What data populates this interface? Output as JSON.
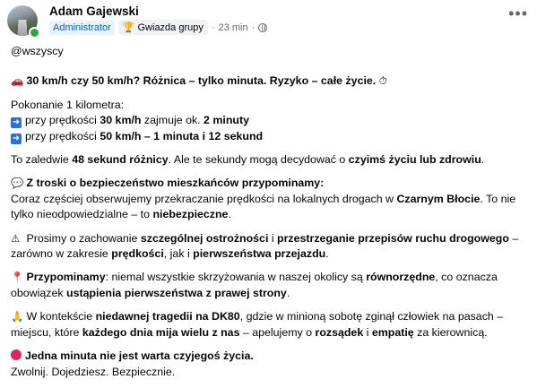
{
  "header": {
    "author": "Adam Gajewski",
    "role_badge": "Administrator",
    "star_badge": "Gwiazda grupy",
    "time": "23 min",
    "more_icon": "•••"
  },
  "post": {
    "mention": "@wszyscy",
    "headline_icon": "🚗",
    "headline": "30 km/h czy 50 km/h? Różnica – tylko minuta. Ryzyko – całe życie.",
    "headline_end_icon": "⏱",
    "distance_intro": "Pokonanie 1 kilometra:",
    "line30_pre": "przy prędkości ",
    "line30_speed": "30 km/h",
    "line30_mid": " zajmuje ok. ",
    "line30_time": "2 minuty",
    "line50_pre": "przy prędkości ",
    "line50_speed": "50 km/h – 1 minuta i 12 sekund",
    "diff_pre": "To zaledwie ",
    "diff_bold": "48 sekund różnicy",
    "diff_mid": ". Ale te sekundy mogą decydować o ",
    "diff_bold2": "czyimś życiu lub zdrowiu",
    "diff_end": ".",
    "care_icon": "💬",
    "care_heading": "Z troski o bezpieczeństwo mieszkańców przypominamy:",
    "care_text_pre": "Coraz częściej obserwujemy przekraczanie prędkości na lokalnych drogach w ",
    "care_place": "Czarnym Błocie",
    "care_text_mid": ". To nie tylko nieodpowiedzialne – to ",
    "care_bold": "niebezpieczne",
    "care_end": ".",
    "warn_icon": "⚠",
    "warn_pre": "Prosimy o zachowanie ",
    "warn_b1": "szczególnej ostrożności",
    "warn_mid": " i ",
    "warn_b2": "przestrzeganie przepisów ruchu drogowego",
    "warn_mid2": " – zarówno w zakresie ",
    "warn_b3": "prędkości",
    "warn_mid3": ", jak i ",
    "warn_b4": "pierwszeństwa przejazdu",
    "warn_end": ".",
    "pin_icon": "📍",
    "remind_bold": "Przypominamy",
    "remind_pre": ": niemal wszystkie skrzyżowania w naszej okolicy są ",
    "remind_b1": "równorzędne",
    "remind_mid": ", co oznacza obowiązek ",
    "remind_b2": "ustąpienia pierwszeństwa z prawej strony",
    "remind_end": ".",
    "tragedy_icon": "🙏",
    "trag_pre": "W kontekście ",
    "trag_b1": "niedawnej tragedii na DK80",
    "trag_mid": ", gdzie w minioną sobotę zginął człowiek na pasach – miejscu, które ",
    "trag_b2": "każdego dnia mija wielu z nas",
    "trag_mid2": " – apelujemy o ",
    "trag_b3": "rozsądek",
    "trag_mid3": " i ",
    "trag_b4": "empatię",
    "trag_end": " za kierownicą.",
    "final_bold": "Jedna minuta nie jest warta czyjegoś życia.",
    "final_text": "Zwolnij. Dojedziesz. Bezpiecznie."
  }
}
